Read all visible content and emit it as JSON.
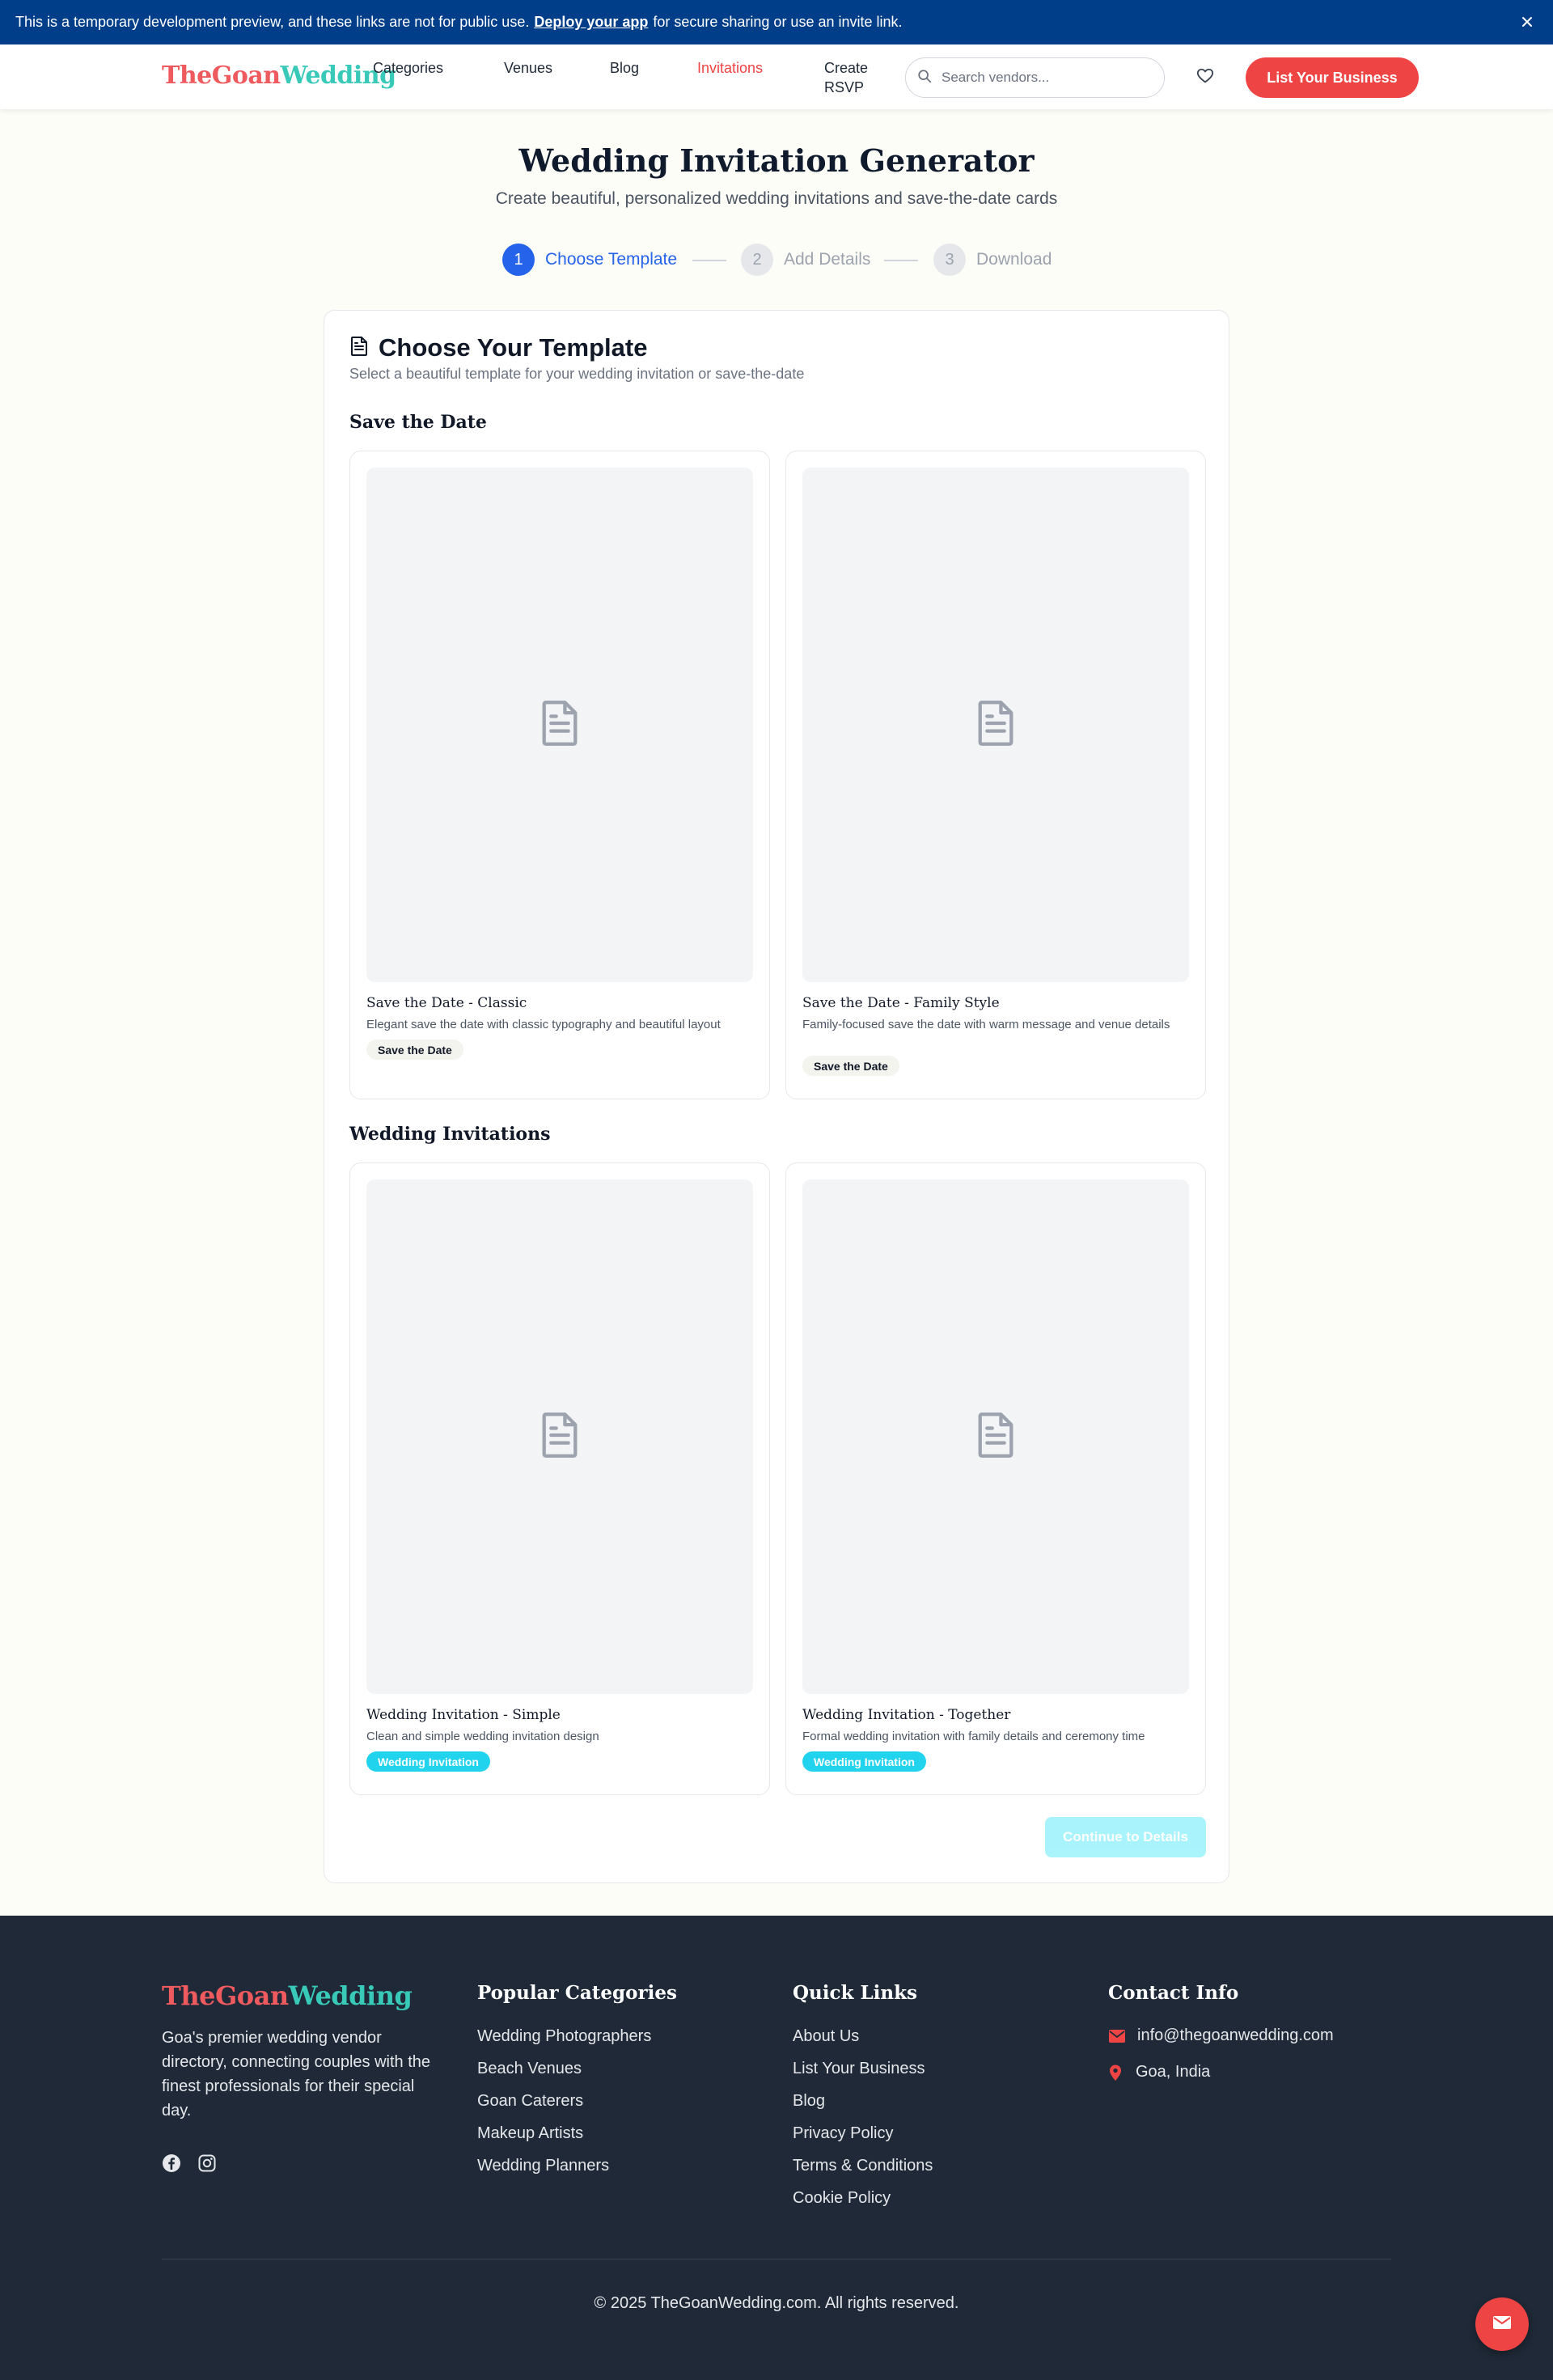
{
  "banner": {
    "text_before": "This is a temporary development preview, and these links are not for public use.",
    "link_text": "Deploy your app",
    "text_after": "for secure sharing or use an invite link."
  },
  "header": {
    "logo_part1": "TheGoan",
    "logo_part2": "Wedding",
    "nav": [
      {
        "label": "Categories"
      },
      {
        "label": "Venues"
      },
      {
        "label": "Blog"
      },
      {
        "label": "Invitations",
        "active": true
      },
      {
        "label": "Create RSVP"
      }
    ],
    "search_placeholder": "Search vendors...",
    "cta_label": "List Your Business"
  },
  "page": {
    "title": "Wedding Invitation Generator",
    "subtitle": "Create beautiful, personalized wedding invitations and save-the-date cards"
  },
  "steps": [
    {
      "num": "1",
      "label": "Choose Template",
      "active": true
    },
    {
      "num": "2",
      "label": "Add Details",
      "active": false
    },
    {
      "num": "3",
      "label": "Download",
      "active": false
    }
  ],
  "card": {
    "title": "Choose Your Template",
    "desc": "Select a beautiful template for your wedding invitation or save-the-date",
    "sections": [
      {
        "title": "Save the Date",
        "templates": [
          {
            "name": "Save the Date - Classic",
            "desc": "Elegant save the date with classic typography and beautiful layout",
            "tag": "Save the Date"
          },
          {
            "name": "Save the Date - Family Style",
            "desc": "Family-focused save the date with warm message and venue details",
            "tag": "Save the Date"
          }
        ]
      },
      {
        "title": "Wedding Invitations",
        "templates": [
          {
            "name": "Wedding Invitation - Simple",
            "desc": "Clean and simple wedding invitation design",
            "tag": "Wedding Invitation"
          },
          {
            "name": "Wedding Invitation - Together",
            "desc": "Formal wedding invitation with family details and ceremony time",
            "tag": "Wedding Invitation"
          }
        ]
      }
    ],
    "continue_label": "Continue to Details"
  },
  "footer": {
    "logo_part1": "TheGoan",
    "logo_part2": "Wedding",
    "about": "Goa's premier wedding vendor directory, connecting couples with the finest professionals for their special day.",
    "categories_title": "Popular Categories",
    "categories": [
      "Wedding Photographers",
      "Beach Venues",
      "Goan Caterers",
      "Makeup Artists",
      "Wedding Planners"
    ],
    "quick_links_title": "Quick Links",
    "quick_links": [
      "About Us",
      "List Your Business",
      "Blog",
      "Privacy Policy",
      "Terms & Conditions",
      "Cookie Policy"
    ],
    "contact_title": "Contact Info",
    "email": "info@thegoanwedding.com",
    "location": "Goa, India",
    "copyright": "© 2025 TheGoanWedding.com. All rights reserved."
  },
  "colors": {
    "brand_red": "#ef4444",
    "brand_teal": "#38c9b8",
    "primary_blue": "#2563eb",
    "banner_blue": "#003e8a",
    "wedding_tag_cyan": "#22d3ee",
    "footer_bg": "#1f2937"
  }
}
